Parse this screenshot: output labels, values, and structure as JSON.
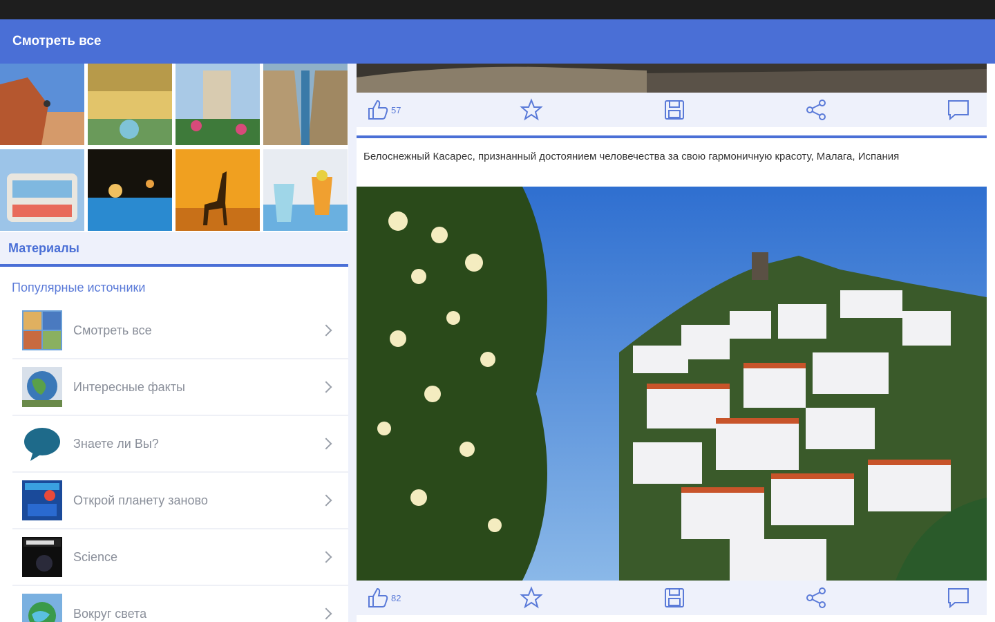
{
  "app_bar": {
    "title": "Смотреть все"
  },
  "left": {
    "section_title": "Материалы",
    "popular_header": "Популярные источники",
    "sources": [
      {
        "label": "Смотреть все",
        "icon": "collage-icon"
      },
      {
        "label": "Интересные факты",
        "icon": "globe-icon"
      },
      {
        "label": "Знаете ли Вы?",
        "icon": "speech-bubble-icon"
      },
      {
        "label": "Открой планету заново",
        "icon": "magazine-icon"
      },
      {
        "label": "Science",
        "icon": "science-cover-icon"
      },
      {
        "label": "Вокруг света",
        "icon": "earth-icon"
      }
    ]
  },
  "feed": {
    "post1": {
      "likes": "57"
    },
    "post2": {
      "caption": "Белоснежный Касарес, признанный достоянием человечества за свою гармоничную красоту, Малага, Испания",
      "likes": "82"
    }
  },
  "colors": {
    "accent": "#4a6fd6",
    "panel": "#eef1fb",
    "status_bar": "#1e1e1e"
  }
}
